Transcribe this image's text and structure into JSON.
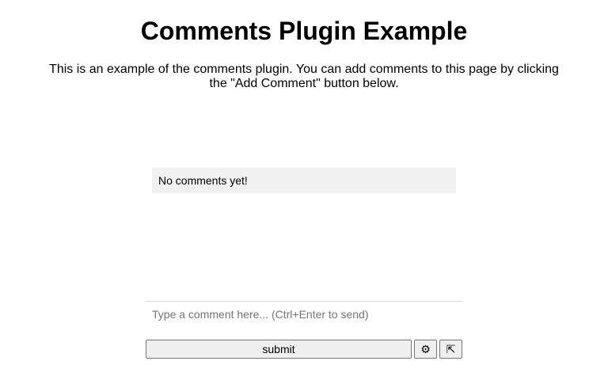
{
  "page": {
    "title": "Comments Plugin Example",
    "description": "This is an example of the comments plugin. You can add comments to this page by clicking the \"Add Comment\" button below."
  },
  "comments": {
    "empty_text": "No comments yet!"
  },
  "composer": {
    "placeholder": "Type a comment here... (Ctrl+Enter to send)",
    "value": "",
    "submit_label": "submit",
    "settings_icon": "gear-icon",
    "expand_icon": "expand-icon"
  }
}
